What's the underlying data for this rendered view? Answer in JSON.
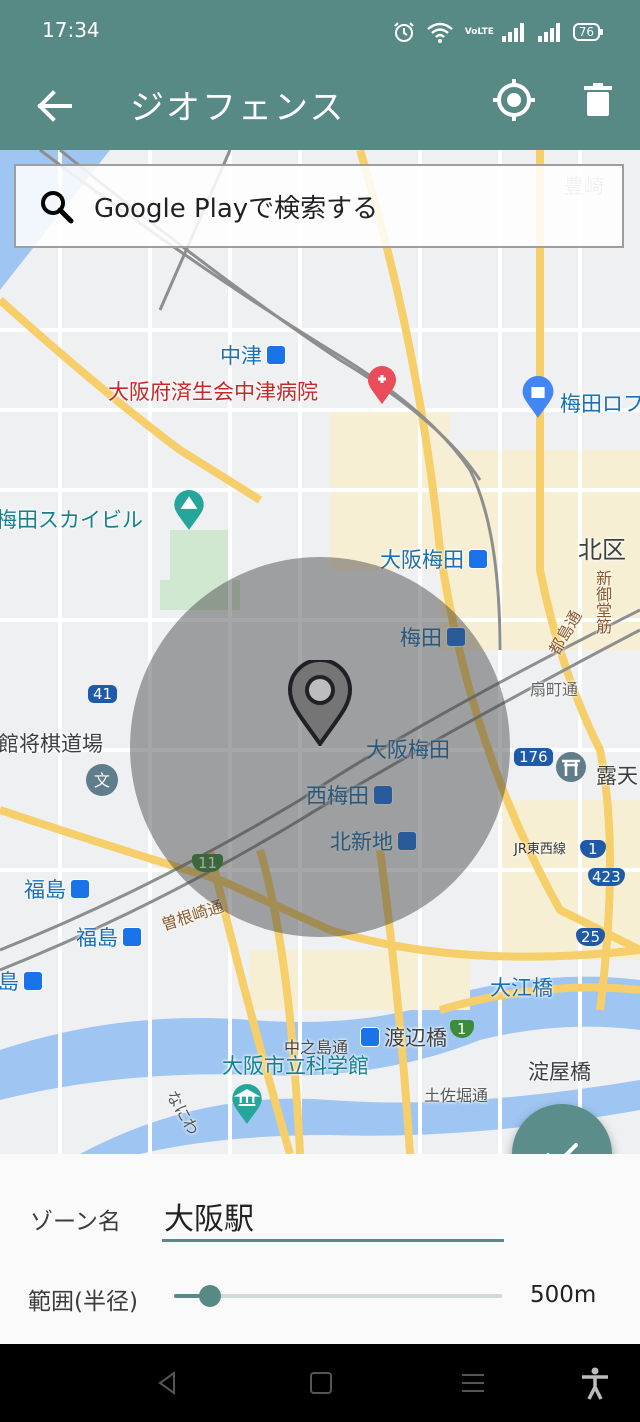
{
  "status_bar": {
    "time": "17:34",
    "icons": [
      "alarm-icon",
      "wifi-icon",
      "volte-icon",
      "signal-icon",
      "signal-icon",
      "battery-icon"
    ],
    "volte": "VoLTE",
    "battery_level": "76"
  },
  "app_bar": {
    "title": "ジオフェンス",
    "back_icon": "arrow-left-icon",
    "locate_icon": "crosshair-icon",
    "delete_icon": "trash-icon"
  },
  "map": {
    "search_text": "Google Playで検索する",
    "labels": {
      "nakatsu": "中津",
      "hospital": "大阪府済生会中津病院",
      "umeda_loft": "梅田ロフ",
      "skybuilding": "梅田スカイビル",
      "kitaku": "北区",
      "osaka_umeda_1": "大阪梅田",
      "umeda": "梅田",
      "osaka_umeda_2": "大阪梅田",
      "nishiumeda": "西梅田",
      "kitashinchi": "北新地",
      "shogi": "館将棋道場",
      "fukushima_1": "福島",
      "fukushima_2": "福島",
      "fukushima_3": "島",
      "sonezaki": "曽根崎通",
      "oebashi": "大江橋",
      "watanabebashi": "渡辺橋",
      "nakanoshima": "中之島通",
      "science": "大阪市立科学館",
      "yodoyabashi": "淀屋橋",
      "tosabori": "土佐堀通",
      "ogimachi": "扇町通",
      "toyosaki": "豊崎",
      "shinmidosuji": "新御堂筋",
      "miyakojima": "都島通",
      "jr_tozai": "JR東西線",
      "tsuyu": "露天",
      "naniwa": "なにわ",
      "route_41": "41",
      "route_176": "176",
      "route_11": "11",
      "route_1": "1",
      "route_423": "423",
      "route_25": "25",
      "route_1b": "1"
    },
    "geofence_marker_icon": "map-pin-icon"
  },
  "fab": {
    "icon": "check-icon"
  },
  "form": {
    "zone_label": "ゾーン名",
    "zone_value": "大阪駅",
    "range_label": "範囲(半径)",
    "range_value": "500m",
    "slider_fraction": 0.11
  },
  "nav_bar": {
    "icons": [
      "back-triangle-icon",
      "home-square-icon",
      "menu-lines-icon",
      "accessibility-icon"
    ]
  }
}
